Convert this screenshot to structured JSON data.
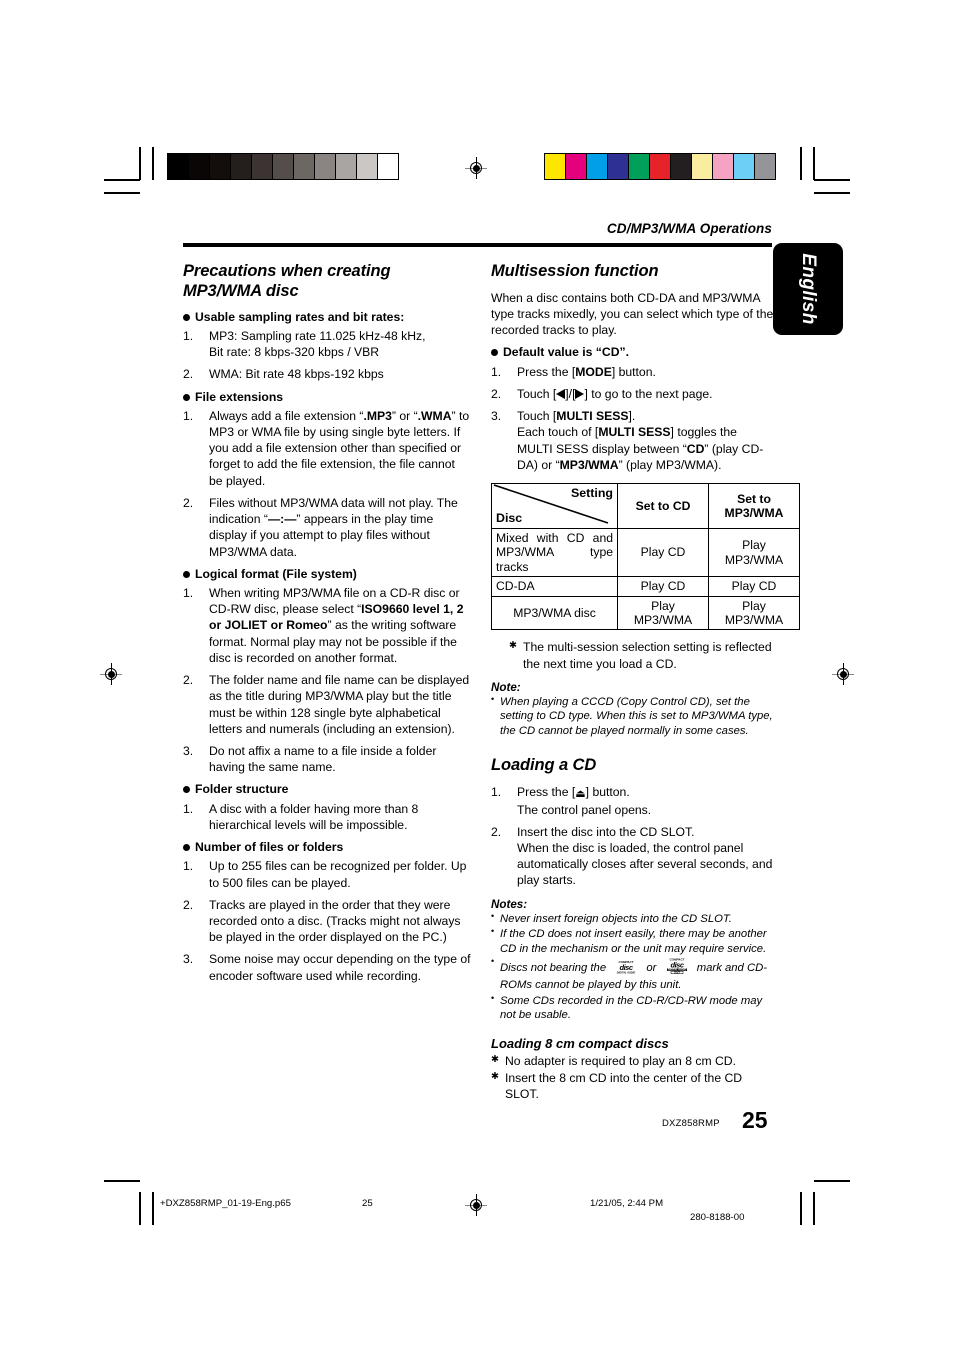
{
  "header": {
    "running_head": "CD/MP3/WMA Operations",
    "language_tab": "English"
  },
  "colorbars": {
    "gray_swatches": [
      "#000000",
      "#0a0605",
      "#130d0c",
      "#241e1c",
      "#3b3432",
      "#544d4a",
      "#6d6764",
      "#8a8582",
      "#a9a5a2",
      "#cac7c5",
      "#ffffff"
    ],
    "color_swatches": [
      "#ffe600",
      "#e5007d",
      "#00a0e9",
      "#2e3192",
      "#00a05a",
      "#e7232a",
      "#231f20",
      "#fbeda0",
      "#f4a3c2",
      "#6dcff6",
      "#939598"
    ]
  },
  "left_column": {
    "title": "Precautions when creating MP3/WMA disc",
    "groups": [
      {
        "heading": "Usable sampling rates and bit rates:",
        "items": [
          {
            "n": "1.",
            "lines": [
              "MP3: Sampling rate  11.025 kHz-48 kHz,",
              "Bit rate: 8 kbps-320 kbps / VBR"
            ]
          },
          {
            "n": "2.",
            "lines": [
              "WMA: Bit rate 48 kbps-192 kbps"
            ]
          }
        ]
      },
      {
        "heading": "File extensions",
        "items": [
          {
            "n": "1.",
            "html": "Always add a file extension “<b>.MP3</b>” or “<b>.WMA</b>” to MP3 or WMA file by using single byte letters. If you add a file extension other than specified or forget to add the file extension, the file cannot be played."
          },
          {
            "n": "2.",
            "html": "Files without MP3/WMA data will not play. The indication “<b>—:—</b>” appears in the play time display if you attempt to play files without MP3/WMA data."
          }
        ]
      },
      {
        "heading": "Logical format (File system)",
        "items": [
          {
            "n": "1.",
            "html": "When writing MP3/WMA file on a CD-R disc or CD-RW disc, please select “<b>ISO9660 level 1, 2 or JOLIET or Romeo</b>” as the writing software format. Normal play may not be possible if the disc is recorded on another format."
          },
          {
            "n": "2.",
            "html": "The folder name and file name can be displayed as the title during MP3/WMA play but the title must be within 128 single byte alphabetical letters and numerals (including an extension)."
          },
          {
            "n": "3.",
            "html": "Do not affix a name to a file inside a folder having the same name."
          }
        ]
      },
      {
        "heading": "Folder structure",
        "items": [
          {
            "n": "1.",
            "html": "A disc with a folder having more than 8 hierarchical levels will be impossible."
          }
        ]
      },
      {
        "heading": "Number of files or folders",
        "items": [
          {
            "n": "1.",
            "html": "Up to 255 files can be recognized per folder. Up to 500 files can be played."
          },
          {
            "n": "2.",
            "html": "Tracks are played in the order that they were recorded onto a disc. (Tracks might not always be played in the order displayed on the PC.)"
          },
          {
            "n": "3.",
            "html": "Some noise may occur depending on the type of encoder software used while recording."
          }
        ]
      }
    ]
  },
  "right_column": {
    "multisession": {
      "title": "Multisession function",
      "intro": "When a disc contains both CD-DA and MP3/WMA type tracks mixedly, you can select which type of the recorded tracks to play.",
      "heading": "Default value is “CD”.",
      "steps": [
        {
          "n": "1.",
          "html": "Press the [<b>MODE</b>] button."
        },
        {
          "n": "2.",
          "html": "Touch [<span class=\"tri-l\"></span>]/[<span class=\"tri-r\"></span>] to go to the next page."
        },
        {
          "n": "3.",
          "html": "Touch [<b>MULTI SESS</b>].<br>Each touch of [<b>MULTI SESS</b>] toggles the MULTI SESS display between “<b>CD</b>” (play CD-DA) or “<b>MP3/WMA</b>” (play MP3/WMA)."
        }
      ],
      "table": {
        "corner_row_label": "Disc",
        "corner_col_label": "Setting",
        "columns": [
          "Set to CD",
          "Set to MP3/WMA"
        ],
        "rows": [
          {
            "disc": "Mixed with CD and MP3/WMA type tracks",
            "set_to_cd": "Play CD",
            "set_to_mp3wma": "Play MP3/WMA"
          },
          {
            "disc": "CD-DA",
            "set_to_cd": "Play CD",
            "set_to_mp3wma": "Play CD"
          },
          {
            "disc": "MP3/WMA disc",
            "set_to_cd": "Play MP3/WMA",
            "set_to_mp3wma": "Play MP3/WMA"
          }
        ]
      },
      "table_footnote": "The multi-session selection setting is reflected the next time you load a CD.",
      "note_title": "Note:",
      "notes": [
        "When playing a CCCD (Copy Control CD), set the setting to CD type. When this is set to MP3/WMA type, the CD cannot be played normally in some cases."
      ]
    },
    "loading_cd": {
      "title": "Loading a CD",
      "steps": [
        {
          "n": "1.",
          "html": "Press the [<span class=\"eject\">⏏</span>] button.<br>The control panel opens."
        },
        {
          "n": "2.",
          "html": "Insert the disc into the CD SLOT.<br>When the disc is loaded, the control panel automatically closes after several seconds, and play starts."
        }
      ],
      "note_title": "Notes:",
      "notes": [
        {
          "html": "Never insert foreign objects into the CD SLOT."
        },
        {
          "html": "If the CD does not insert easily, there may be another CD in the mechanism or the unit may require service."
        },
        {
          "html": "Discs not bearing the <span class=\"cdlogo\" data-name=\"compact-disc-digital-audio-logo-icon\"></span> or <span class=\"cdlogo\" data-name=\"compact-disc-text-logo-icon\"></span> mark and CD-ROMs cannot be played by this unit."
        },
        {
          "html": "Some CDs recorded in the CD-R/CD-RW mode may not be usable."
        }
      ]
    },
    "loading_8cm": {
      "title": "Loading 8 cm compact discs",
      "items": [
        "No adapter is required to play an 8 cm CD.",
        "Insert the 8 cm CD into the center of the CD SLOT."
      ]
    }
  },
  "footer": {
    "model": "DXZ858RMP",
    "page_number": "25",
    "file_name": "+DXZ858RMP_01-19-Eng.p65",
    "page_marker": "25",
    "date_time": "1/21/05, 2:44 PM",
    "doc_code": "280-8188-00"
  }
}
